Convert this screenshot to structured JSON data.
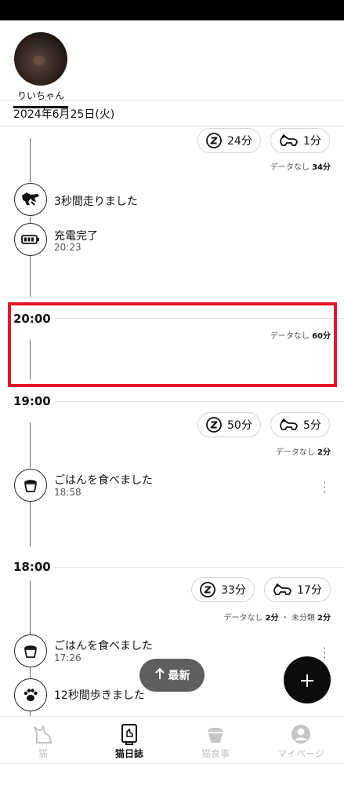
{
  "profile": {
    "name": "りいちゃん"
  },
  "date": "2024年6月25日(火)",
  "top_block": {
    "sleep": "24分",
    "walk": "1分",
    "stat_label": "データなし",
    "stat_value": "34分",
    "events": [
      {
        "title": "3秒間走りました",
        "icon": "running-cat-icon"
      },
      {
        "title": "充電完了",
        "time": "20:23",
        "icon": "battery-icon"
      }
    ]
  },
  "hour_20": {
    "label": "20:00",
    "stat_label": "データなし",
    "stat_value": "60分"
  },
  "hour_19": {
    "label": "19:00",
    "sleep": "50分",
    "walk": "5分",
    "stat_label": "データなし",
    "stat_value": "2分",
    "events": [
      {
        "title": "ごはんを食べました",
        "time": "18:58",
        "icon": "food-bowl-icon"
      }
    ]
  },
  "hour_18": {
    "label": "18:00",
    "sleep": "33分",
    "walk": "17分",
    "stat_label": "データなし",
    "stat_value": "2分",
    "stat2_label": "未分類",
    "stat2_value": "2分",
    "events": [
      {
        "title": "ごはんを食べました",
        "time": "17:26",
        "icon": "food-bowl-icon"
      },
      {
        "title": "12秒間歩きました",
        "icon": "paw-icon"
      }
    ]
  },
  "latest_button": "最新",
  "nav": [
    {
      "label": "猫",
      "icon": "cat-icon",
      "active": false
    },
    {
      "label": "猫日誌",
      "icon": "diary-icon",
      "active": true
    },
    {
      "label": "猫食事",
      "icon": "food-bowl-icon",
      "active": false
    },
    {
      "label": "マイページ",
      "icon": "user-icon",
      "active": false
    }
  ],
  "colors": {
    "highlight": "#e5142a",
    "fab": "#0c0c0c",
    "latest_bg": "#5f5f5f",
    "nav_inactive": "#c5c5c5"
  }
}
